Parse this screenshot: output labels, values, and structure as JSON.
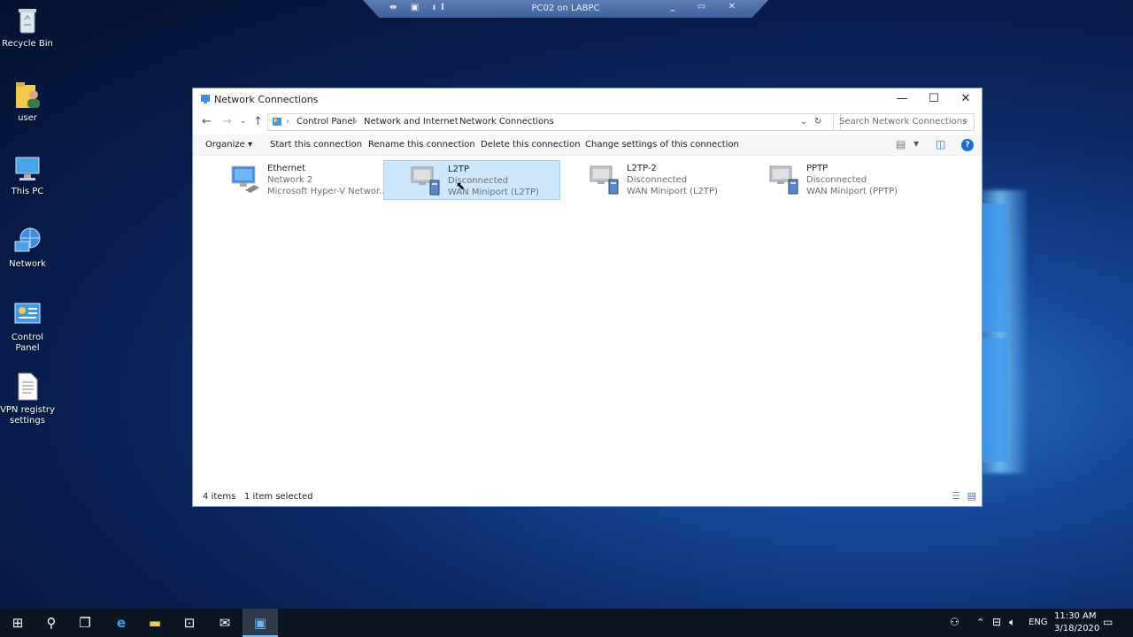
{
  "rdp_bar": {
    "title": "PC02 on LABPC"
  },
  "desktop": {
    "icons": [
      {
        "label": "Recycle Bin",
        "icon": "recycle-bin-icon"
      },
      {
        "label": "user",
        "icon": "user-folder-icon"
      },
      {
        "label": "This PC",
        "icon": "this-pc-icon"
      },
      {
        "label": "Network",
        "icon": "network-icon"
      },
      {
        "label": "Control Panel",
        "icon": "control-panel-icon"
      },
      {
        "label": "VPN registry settings",
        "icon": "document-icon"
      }
    ]
  },
  "window": {
    "title": "Network Connections",
    "controls": {
      "minimize": "—",
      "maximize": "☐",
      "close": "✕"
    },
    "breadcrumb": [
      "Control Panel",
      "Network and Internet",
      "Network Connections"
    ],
    "search_placeholder": "Search Network Connections",
    "toolbar": {
      "organize": "Organize ▾",
      "start": "Start this connection",
      "rename": "Rename this connection",
      "delete": "Delete this connection",
      "change": "Change settings of this connection"
    },
    "items": [
      {
        "name": "Ethernet",
        "status": "Network  2",
        "device": "Microsoft Hyper-V Networ...",
        "icon": "ethernet-adapter-icon",
        "selected": false
      },
      {
        "name": "L2TP",
        "status": "Disconnected",
        "device": "WAN Miniport (L2TP)",
        "icon": "vpn-connection-icon",
        "selected": true
      },
      {
        "name": "L2TP-2",
        "status": "Disconnected",
        "device": "WAN Miniport (L2TP)",
        "icon": "vpn-connection-icon",
        "selected": false
      },
      {
        "name": "PPTP",
        "status": "Disconnected",
        "device": "WAN Miniport (PPTP)",
        "icon": "vpn-connection-icon",
        "selected": false
      }
    ],
    "status_bar": {
      "count": "4 items",
      "selection": "1 item selected"
    }
  },
  "taskbar": {
    "language": "ENG",
    "time": "11:30 AM",
    "date": "3/18/2020"
  }
}
